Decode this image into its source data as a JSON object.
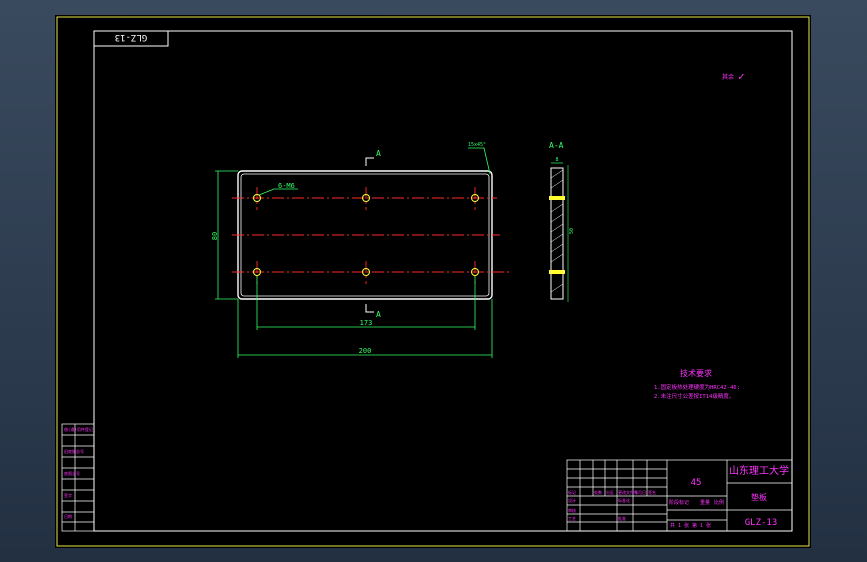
{
  "title_flipped": "GLZ-13",
  "roughness_symbol": "✓",
  "roughness_mark": "其余",
  "view_label_top": "A",
  "view_label_bottom": "A",
  "section_title": "A-A",
  "hole_callout": "6-M6",
  "corner_note": "15x45°",
  "dim_height": "80",
  "dim_hole_spacing": "173",
  "dim_width": "200",
  "section_dim_top": "8",
  "section_dim_side": "50",
  "tech_req_title": "技术要求",
  "tech_req_lines": [
    "1.固定板热处理硬度为HRC42-46;",
    "2.未注尺寸公差按IT14级精度。"
  ],
  "material": "45",
  "school": "山东理工大学",
  "part_name": "垫板",
  "drawing_no": "GLZ-13",
  "title_block_labels": [
    "标记",
    "处数",
    "分区",
    "更改文件号",
    "签名",
    "年月日"
  ],
  "stage_label": "阶段标记",
  "weight_label": "重量",
  "scale_label": "比例",
  "sheet_info": "共 1 张 第 1 张",
  "row_labels": [
    "设计",
    "标准化",
    "审核",
    "工艺",
    "批准"
  ],
  "side_table": [
    "借(通)用件登记",
    "",
    "旧底图总号",
    "",
    "底图总号",
    "",
    "签字",
    "",
    "日期",
    ""
  ],
  "colors": {
    "border": "#e8e84a",
    "frame": "#ffffff",
    "outline": "#ffffff",
    "center": "#ff2a2a",
    "dim": "#33ff66",
    "text": "#ff33ff",
    "yellow": "#ffff33"
  }
}
